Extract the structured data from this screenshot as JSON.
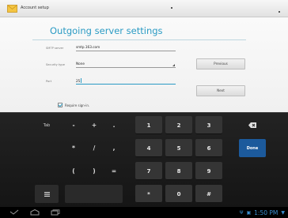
{
  "action_bar": {
    "title": "Account setup",
    "app_icon": "email-envelope-icon"
  },
  "form": {
    "page_title": "Outgoing server settings",
    "smtp_label": "SMTP server",
    "smtp_value": "smtp.163.com",
    "security_label": "Security type",
    "security_value": "None",
    "port_label": "Port",
    "port_value": "25",
    "require_signin_label": "Require sign-in.",
    "require_signin_checked": true
  },
  "buttons": {
    "previous": "Previous",
    "next": "Next"
  },
  "keyboard": {
    "tab": "Tab",
    "minus": "-",
    "plus": "+",
    "period": ".",
    "asterisk": "*",
    "slash": "/",
    "comma": ",",
    "lparen": "(",
    "rparen": ")",
    "equals": "=",
    "k1": "1",
    "k2": "2",
    "k3": "3",
    "k4": "4",
    "k5": "5",
    "k6": "6",
    "k7": "7",
    "k8": "8",
    "k9": "9",
    "star": "*",
    "k0": "0",
    "hash": "#",
    "done": "Done",
    "backspace_icon": "backspace-icon",
    "settings_icon": "keyboard-settings-icon"
  },
  "system_bar": {
    "time": "1:50 PM",
    "nav_icons": [
      "back-icon",
      "home-icon",
      "recent-apps-icon"
    ],
    "status_icons": [
      "usb-icon",
      "screenshot-icon",
      "wifi-icon"
    ]
  }
}
